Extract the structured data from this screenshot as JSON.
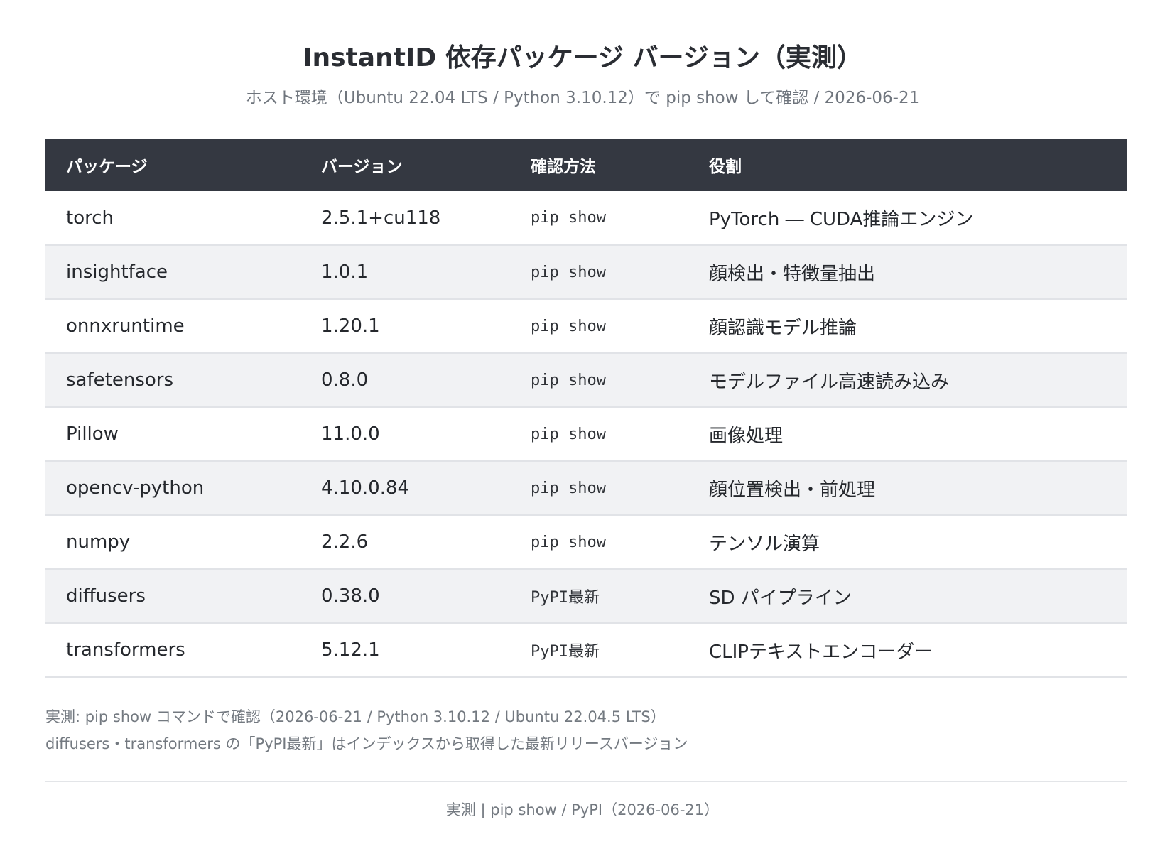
{
  "header": {
    "title": "InstantID 依存パッケージ バージョン（実測）",
    "subtitle": "ホスト環境（Ubuntu 22.04 LTS / Python 3.10.12）で pip show して確認 / 2026-06-21"
  },
  "table": {
    "columns": [
      "パッケージ",
      "バージョン",
      "確認方法",
      "役割"
    ],
    "rows": [
      {
        "package": "torch",
        "version": "2.5.1+cu118",
        "method": "pip show",
        "role": "PyTorch ― CUDA推論エンジン"
      },
      {
        "package": "insightface",
        "version": "1.0.1",
        "method": "pip show",
        "role": "顔検出・特徴量抽出"
      },
      {
        "package": "onnxruntime",
        "version": "1.20.1",
        "method": "pip show",
        "role": "顔認識モデル推論"
      },
      {
        "package": "safetensors",
        "version": "0.8.0",
        "method": "pip show",
        "role": "モデルファイル高速読み込み"
      },
      {
        "package": "Pillow",
        "version": "11.0.0",
        "method": "pip show",
        "role": "画像処理"
      },
      {
        "package": "opencv-python",
        "version": "4.10.0.84",
        "method": "pip show",
        "role": "顔位置検出・前処理"
      },
      {
        "package": "numpy",
        "version": "2.2.6",
        "method": "pip show",
        "role": "テンソル演算"
      },
      {
        "package": "diffusers",
        "version": "0.38.0",
        "method": "PyPI最新",
        "role": "SD パイプライン"
      },
      {
        "package": "transformers",
        "version": "5.12.1",
        "method": "PyPI最新",
        "role": "CLIPテキストエンコーダー"
      }
    ]
  },
  "notes": [
    "実測: pip show コマンドで確認（2026-06-21 / Python 3.10.12 / Ubuntu 22.04.5 LTS）",
    "diffusers・transformers の「PyPI最新」はインデックスから取得した最新リリースバージョン"
  ],
  "footer": {
    "source": "実測 | pip show / PyPI（2026-06-21）"
  }
}
